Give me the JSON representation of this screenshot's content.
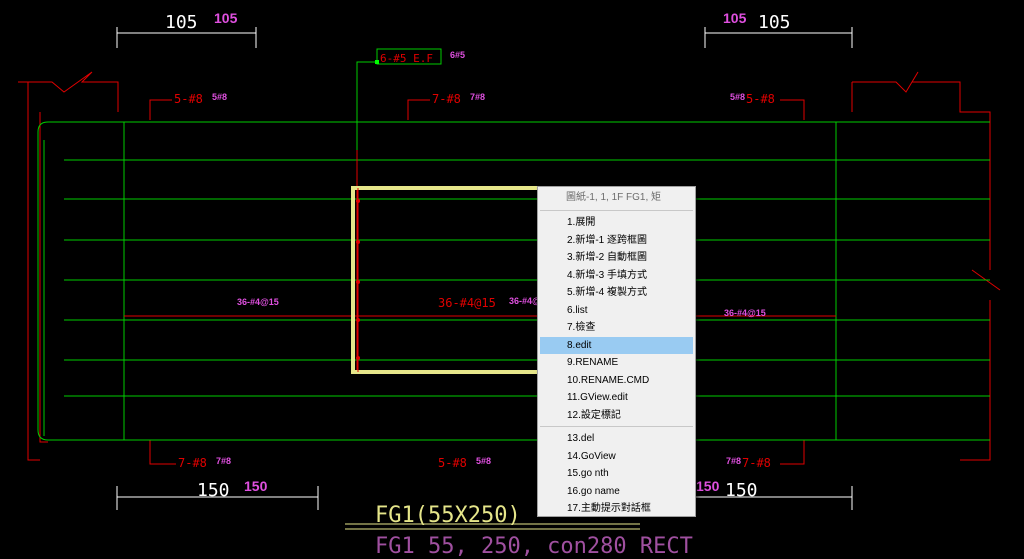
{
  "dimensions": {
    "top_left": "105",
    "top_left_mag": "105",
    "top_right": "105",
    "top_right_mag": "105",
    "bottom_left": "150",
    "bottom_left_mag": "150",
    "bottom_right": "150",
    "bottom_right_mag": "150"
  },
  "rebars": {
    "stirrup_tag": "6-#5 E.F",
    "stirrup_tag_mag": "6#5",
    "top_left": "5-#8",
    "top_left_mag": "5#8",
    "top_mid": "7-#8",
    "top_mid_mag": "7#8",
    "top_right": "5-#8",
    "top_right_mag": "5#8",
    "side_left_mag": "36-#4@15",
    "side_mid": "36-#4@15",
    "side_mid_mag": "36-#4@",
    "side_right_mag": "36-#4@15",
    "bottom_left": "7-#8",
    "bottom_left_mag": "7#8",
    "bottom_mid": "5-#8",
    "bottom_mid_mag": "5#8",
    "bottom_right": "7-#8",
    "bottom_right_mag": "7#8"
  },
  "beam": {
    "name": "FG1(55X250)",
    "spec": "FG1 55, 250, con280 RECT"
  },
  "colors": {
    "background": "#000000",
    "green": "#00cc00",
    "red": "#e00000",
    "magenta": "#e050e0",
    "yellow": "#e6e68a",
    "white": "#ffffff",
    "menu_highlight": "#99cbf2"
  },
  "context_menu": {
    "title": "圖紙-1, 1, 1F FG1, 矩",
    "items": [
      "1.展開",
      "2.新增-1 逐跨框圖",
      "3.新增-2 自動框圖",
      "4.新增-3 手填方式",
      "5.新增-4 複製方式",
      "6.list",
      "7.檢查",
      "8.edit",
      "9.RENAME",
      "10.RENAME.CMD",
      "11.GView.edit",
      "12.設定標記",
      "13.del",
      "14.GoView",
      "15.go nth",
      "16.go name",
      "17.主動提示對話框"
    ],
    "selected": "8.edit"
  }
}
